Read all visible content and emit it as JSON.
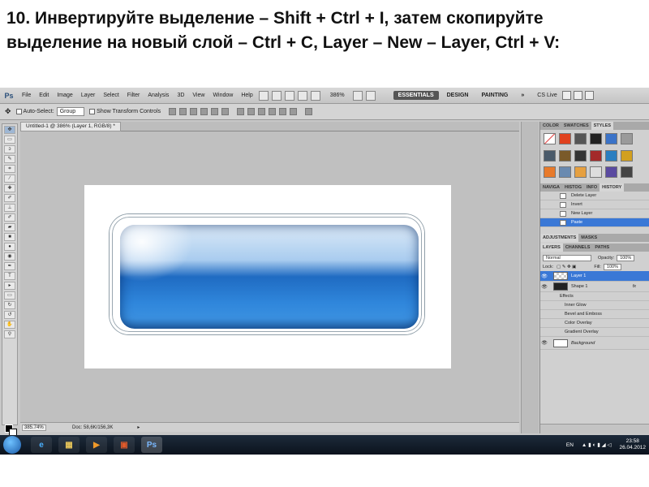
{
  "slide": {
    "title": "10. Инвертируйте выделение – Shift + Ctrl + I, затем скопируйте выделение на новый слой – Ctrl + C, Layer – New – Layer, Ctrl + V:"
  },
  "photoshop": {
    "logo": "Ps",
    "menu": [
      "File",
      "Edit",
      "Image",
      "Layer",
      "Select",
      "Filter",
      "Analysis",
      "3D",
      "View",
      "Window",
      "Help"
    ],
    "zoom": "386%",
    "workspaces": [
      "ESSENTIALS",
      "DESIGN",
      "PAINTING"
    ],
    "more": "»",
    "cslive": "CS Live",
    "options": {
      "auto_select_label": "Auto-Select:",
      "auto_select_value": "Group",
      "transform_label": "Show Transform Controls"
    },
    "document": {
      "tab_title": "Untitled-1 @ 386% (Layer 1, RGB/8) *",
      "status_zoom": "385.74%",
      "status_doc": "Doc: 58,6K/156,3K"
    },
    "styles_tabs": [
      "COLOR",
      "SWATCHES",
      "STYLES"
    ],
    "history_tabs": [
      "NAVIGA",
      "HISTOG",
      "INFO",
      "HISTORY"
    ],
    "history_items": [
      "Delete Layer",
      "Invert",
      "New Layer",
      "Paste"
    ],
    "adjustments_tabs": [
      "ADJUSTMENTS",
      "MASKS"
    ],
    "layers_tabs": [
      "LAYERS",
      "CHANNELS",
      "PATHS"
    ],
    "blend_mode": "Normal",
    "opacity_label": "Opacity:",
    "opacity_value": "100%",
    "lock_label": "Lock:",
    "fill_label": "Fill:",
    "fill_value": "100%",
    "layers": [
      {
        "name": "Layer 1"
      },
      {
        "name": "Shape 1",
        "fx": "fx"
      },
      {
        "name": "Effects"
      },
      {
        "name": "Inner Glow"
      },
      {
        "name": "Bevel and Emboss"
      },
      {
        "name": "Color Overlay"
      },
      {
        "name": "Gradient Overlay"
      },
      {
        "name": "Background"
      }
    ]
  },
  "taskbar": {
    "lang": "EN",
    "time": "23:58",
    "date": "26.04.2012"
  },
  "colors": {
    "selection": "#3a78d6",
    "button_blue": "#1f6bc2"
  }
}
